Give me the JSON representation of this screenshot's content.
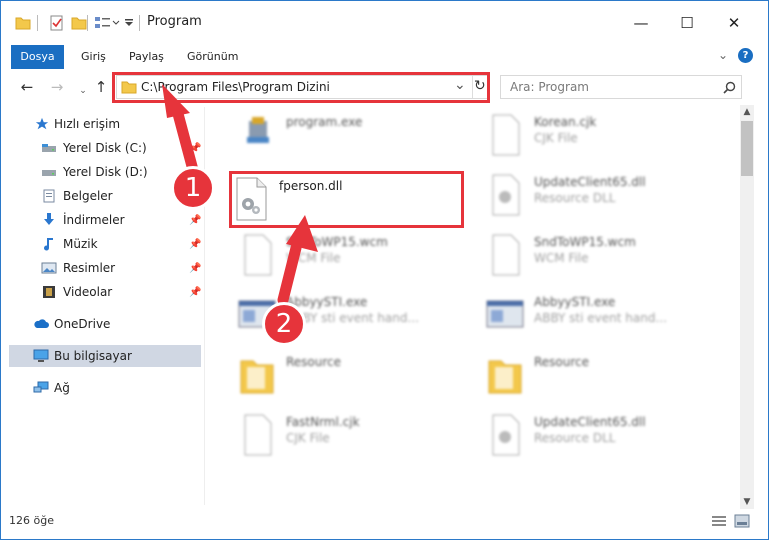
{
  "window": {
    "title": "Program",
    "minimize": "—",
    "maximize": "☐",
    "close": "✕"
  },
  "ribbon": {
    "tabs": [
      "Dosya",
      "Giriş",
      "Paylaş",
      "Görünüm"
    ],
    "expand": "⌄",
    "help": "?"
  },
  "address": {
    "path": "C:\\Program Files\\Program Dizini",
    "dropdown": "⌄",
    "refresh": "↻",
    "search_placeholder": "Ara: Program"
  },
  "sidebar": {
    "items": [
      {
        "label": "Hızlı erişim",
        "icon": "star-icon"
      },
      {
        "label": "Yerel Disk (C:)",
        "icon": "drive-icon",
        "pinned": true
      },
      {
        "label": "Yerel Disk (D:)",
        "icon": "drive-icon"
      },
      {
        "label": "Belgeler",
        "icon": "documents-icon"
      },
      {
        "label": "İndirmeler",
        "icon": "download-icon",
        "pinned": true
      },
      {
        "label": "Müzik",
        "icon": "music-icon",
        "pinned": true
      },
      {
        "label": "Resimler",
        "icon": "pictures-icon",
        "pinned": true
      },
      {
        "label": "Videolar",
        "icon": "video-icon",
        "pinned": true
      },
      {
        "label": "OneDrive",
        "icon": "cloud-icon"
      },
      {
        "label": "Bu bilgisayar",
        "icon": "computer-icon",
        "selected": true
      },
      {
        "label": "Ağ",
        "icon": "network-icon"
      }
    ]
  },
  "files": [
    {
      "name": "program.exe",
      "type": "",
      "icon": "exe-icon"
    },
    {
      "name": "Korean.cjk",
      "type": "CJK File",
      "icon": "file-icon"
    },
    {
      "name": "fperson.dll",
      "type": "",
      "icon": "dll-icon"
    },
    {
      "name": "UpdateClient65.dll",
      "type": "Resource DLL",
      "icon": "dll-icon"
    },
    {
      "name": "SndToWP15.wcm",
      "type": "WCM File",
      "icon": "file-icon"
    },
    {
      "name": "SndToWP15.wcm",
      "type": "WCM File",
      "icon": "file-icon"
    },
    {
      "name": "AbbyySTI.exe",
      "type": "ABBY sti event hand...",
      "icon": "app-icon"
    },
    {
      "name": "AbbyySTI.exe",
      "type": "ABBY sti event hand...",
      "icon": "app-icon"
    },
    {
      "name": "Resource",
      "type": "",
      "icon": "folder-icon"
    },
    {
      "name": "Resource",
      "type": "",
      "icon": "folder-icon"
    },
    {
      "name": "FastNrml.cjk",
      "type": "CJK File",
      "icon": "file-icon"
    },
    {
      "name": "UpdateClient65.dll",
      "type": "Resource DLL",
      "icon": "dll-icon"
    }
  ],
  "status": {
    "count": "126 öğe"
  },
  "annotations": {
    "step1": "1",
    "step2": "2"
  },
  "colors": {
    "accent": "#1a6ec2",
    "highlight": "#e6343b",
    "selected": "#d0d7e3"
  }
}
